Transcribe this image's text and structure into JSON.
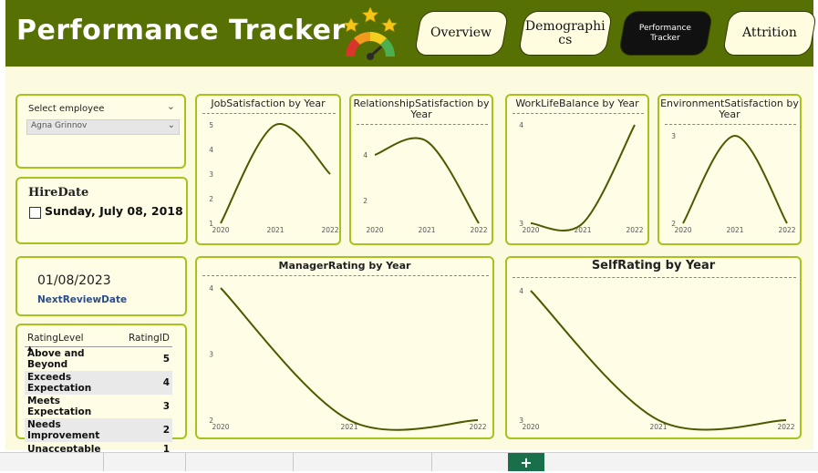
{
  "header": {
    "title": "Performance Tracker"
  },
  "nav": {
    "overview": "Overview",
    "demographics": "Demographi\ncs",
    "performance": "Performance\nTracker",
    "attrition": "Attrition"
  },
  "slicer": {
    "label": "Select employee",
    "selected": "Agna Grinnov"
  },
  "hire_date": {
    "label": "HireDate",
    "value": "Sunday, July 08, 2018"
  },
  "next_review": {
    "value": "01/08/2023",
    "label": "NextReviewDate"
  },
  "rating_table": {
    "headers": [
      "RatingLevel",
      "RatingID"
    ],
    "rows": [
      {
        "level": "Above and Beyond",
        "id": "5"
      },
      {
        "level": "Exceeds Expectation",
        "id": "4"
      },
      {
        "level": "Meets Expectation",
        "id": "3"
      },
      {
        "level": "Needs Improvement",
        "id": "2"
      },
      {
        "level": "Unacceptable",
        "id": "1"
      }
    ]
  },
  "colors": {
    "line": "#4b5a00",
    "border": "#a5c21d",
    "header": "#567004",
    "panel": "#fffde6"
  },
  "chart_data": [
    {
      "id": "job",
      "type": "line",
      "title": "JobSatisfaction by Year",
      "x": [
        "2020",
        "2021",
        "2022"
      ],
      "y": [
        1,
        5,
        3
      ],
      "yticks": [
        "1",
        "2",
        "3",
        "4",
        "5"
      ],
      "ylim": [
        1,
        5
      ],
      "curve": "smooth"
    },
    {
      "id": "rel",
      "type": "line",
      "title": "RelationshipSatisfaction by Year",
      "x": [
        "2020",
        "2021",
        "2022"
      ],
      "y": [
        4,
        4.6,
        1
      ],
      "yticks": [
        "2",
        "4"
      ],
      "ylim": [
        1,
        5
      ],
      "curve": "smooth"
    },
    {
      "id": "wlb",
      "type": "line",
      "title": "WorkLifeBalance by Year",
      "x": [
        "2020",
        "2021",
        "2022"
      ],
      "y": [
        3,
        3,
        4
      ],
      "yticks": [
        "3",
        "4"
      ],
      "ylim": [
        3,
        4
      ],
      "curve": "smooth"
    },
    {
      "id": "env",
      "type": "line",
      "title": "EnvironmentSatisfaction by Year",
      "x": [
        "2020",
        "2021",
        "2022"
      ],
      "y": [
        2,
        3,
        2
      ],
      "yticks": [
        "2",
        "3"
      ],
      "ylim": [
        2,
        3
      ],
      "curve": "smooth"
    },
    {
      "id": "mgr",
      "type": "line",
      "title": "ManagerRating by Year",
      "x": [
        "2020",
        "2021",
        "2022"
      ],
      "y": [
        4,
        2,
        2
      ],
      "yticks": [
        "2",
        "3",
        "4"
      ],
      "ylim": [
        2,
        4
      ],
      "curve": "smooth"
    },
    {
      "id": "self",
      "type": "line",
      "title": "SelfRating by Year",
      "x": [
        "2020",
        "2021",
        "2022"
      ],
      "y": [
        4,
        3,
        3
      ],
      "yticks": [
        "3",
        "4"
      ],
      "ylim": [
        3,
        4
      ],
      "curve": "smooth"
    }
  ]
}
